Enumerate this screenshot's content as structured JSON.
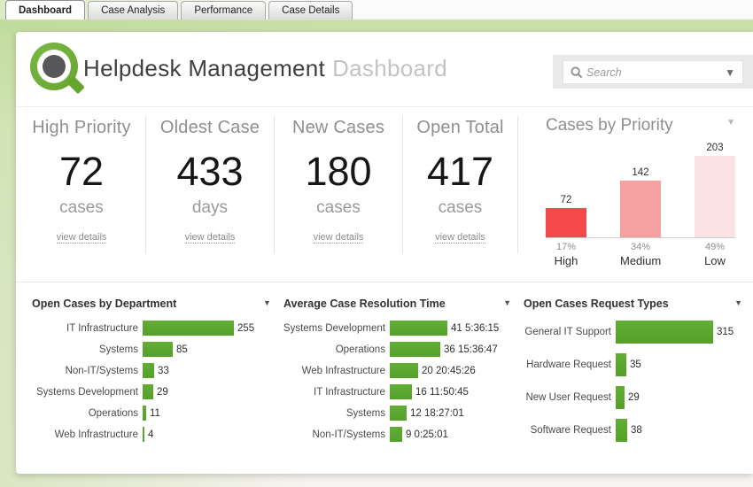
{
  "tabs": [
    {
      "label": "Dashboard",
      "active": true
    },
    {
      "label": "Case Analysis",
      "active": false
    },
    {
      "label": "Performance",
      "active": false
    },
    {
      "label": "Case Details",
      "active": false
    }
  ],
  "header": {
    "title": "Helpdesk Management",
    "subtitle": "Dashboard",
    "search_placeholder": "Search"
  },
  "kpis": [
    {
      "label": "High Priority",
      "value": "72",
      "unit": "cases",
      "link": "view details"
    },
    {
      "label": "Oldest Case",
      "value": "433",
      "unit": "days",
      "link": "view details"
    },
    {
      "label": "New Cases",
      "value": "180",
      "unit": "cases",
      "link": "view details"
    },
    {
      "label": "Open Total",
      "value": "417",
      "unit": "cases",
      "link": "view details"
    }
  ],
  "colors": {
    "green_bar": "#57a52c",
    "priority_high": "#f4494b",
    "priority_medium": "#f5a0a1",
    "priority_low": "#fbe2e4",
    "band_green": "#c7dfa5"
  },
  "chart_data": [
    {
      "type": "bar",
      "title": "Cases by Priority",
      "orientation": "vertical",
      "categories": [
        "High",
        "Medium",
        "Low"
      ],
      "values": [
        72,
        142,
        203
      ],
      "percent_labels": [
        "17%",
        "34%",
        "49%"
      ],
      "bar_colors": [
        "#f4494b",
        "#f5a0a1",
        "#fbe2e4"
      ],
      "ylim": [
        0,
        203
      ],
      "grid": false,
      "legend": "none"
    },
    {
      "type": "bar",
      "title": "Open Cases by Department",
      "orientation": "horizontal",
      "categories": [
        "IT Infrastructure",
        "Systems",
        "Non-IT/Systems",
        "Systems Development",
        "Operations",
        "Web Infrastructure"
      ],
      "values": [
        255,
        85,
        33,
        29,
        11,
        4
      ],
      "bar_color": "#57a52c",
      "grid": false,
      "legend": "none"
    },
    {
      "type": "bar",
      "title": "Average Case Resolution Time",
      "orientation": "horizontal",
      "categories": [
        "Systems Development",
        "Operations",
        "Web Infrastructure",
        "IT Infrastructure",
        "Systems",
        "Non-IT/Systems"
      ],
      "values": [
        41,
        36,
        20,
        16,
        12,
        9
      ],
      "value_labels": [
        "41 5:36:15",
        "36 15:36:47",
        "20 20:45:26",
        "16 11:50:45",
        "12 18:27:01",
        "9 0:25:01"
      ],
      "bar_color": "#57a52c",
      "grid": false,
      "legend": "none"
    },
    {
      "type": "bar",
      "title": "Open Cases Request Types",
      "orientation": "horizontal",
      "categories": [
        "General IT Support",
        "Hardware Request",
        "New User Request",
        "Software Request"
      ],
      "values": [
        315,
        35,
        29,
        38
      ],
      "bar_color": "#57a52c",
      "grid": false,
      "legend": "none"
    }
  ]
}
